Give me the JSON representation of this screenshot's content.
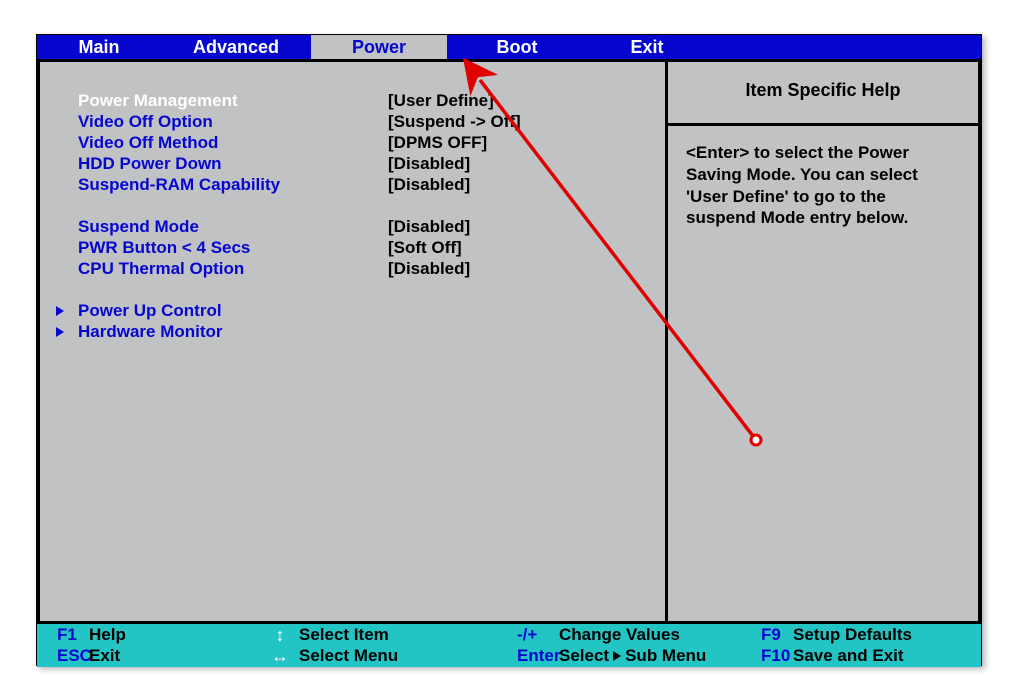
{
  "tabs": [
    {
      "label": "Main",
      "width": 124
    },
    {
      "label": "Advanced",
      "width": 150
    },
    {
      "label": "Power",
      "width": 136,
      "active": true
    },
    {
      "label": "Boot",
      "width": 140
    },
    {
      "label": "Exit",
      "width": 120
    }
  ],
  "settings": {
    "group1": [
      {
        "label": "Power Management",
        "value": "[User Define]",
        "hl": true
      },
      {
        "label": "Video Off Option",
        "value": "[Suspend -> Off]"
      },
      {
        "label": "Video Off Method",
        "value": "[DPMS OFF]"
      },
      {
        "label": "HDD Power Down",
        "value": "[Disabled]"
      },
      {
        "label": "Suspend-RAM Capability",
        "value": "[Disabled]"
      }
    ],
    "group2": [
      {
        "label": "Suspend Mode",
        "value": "[Disabled]"
      },
      {
        "label": "PWR Button < 4 Secs",
        "value": "[Soft Off]"
      },
      {
        "label": "CPU Thermal Option",
        "value": "[Disabled]"
      }
    ],
    "subs": [
      {
        "label": "Power Up Control"
      },
      {
        "label": "Hardware Monitor"
      }
    ]
  },
  "help": {
    "title": "Item Specific Help",
    "text": "<Enter> to select the Power Saving Mode. You can select 'User Define' to go to the suspend Mode entry below."
  },
  "footer": {
    "r1": {
      "k1": "F1",
      "l1": "Help",
      "l2": "Select Item",
      "k3": "-/+",
      "l3": "Change Values",
      "k4": "F9",
      "l4": "Setup Defaults"
    },
    "r2": {
      "k1": "ESC",
      "l1": "Exit",
      "l2": "Select Menu",
      "k3": "Enter",
      "l3a": "Select",
      "l3b": "Sub Menu",
      "k4": "F10",
      "l4": "Save and Exit"
    }
  }
}
